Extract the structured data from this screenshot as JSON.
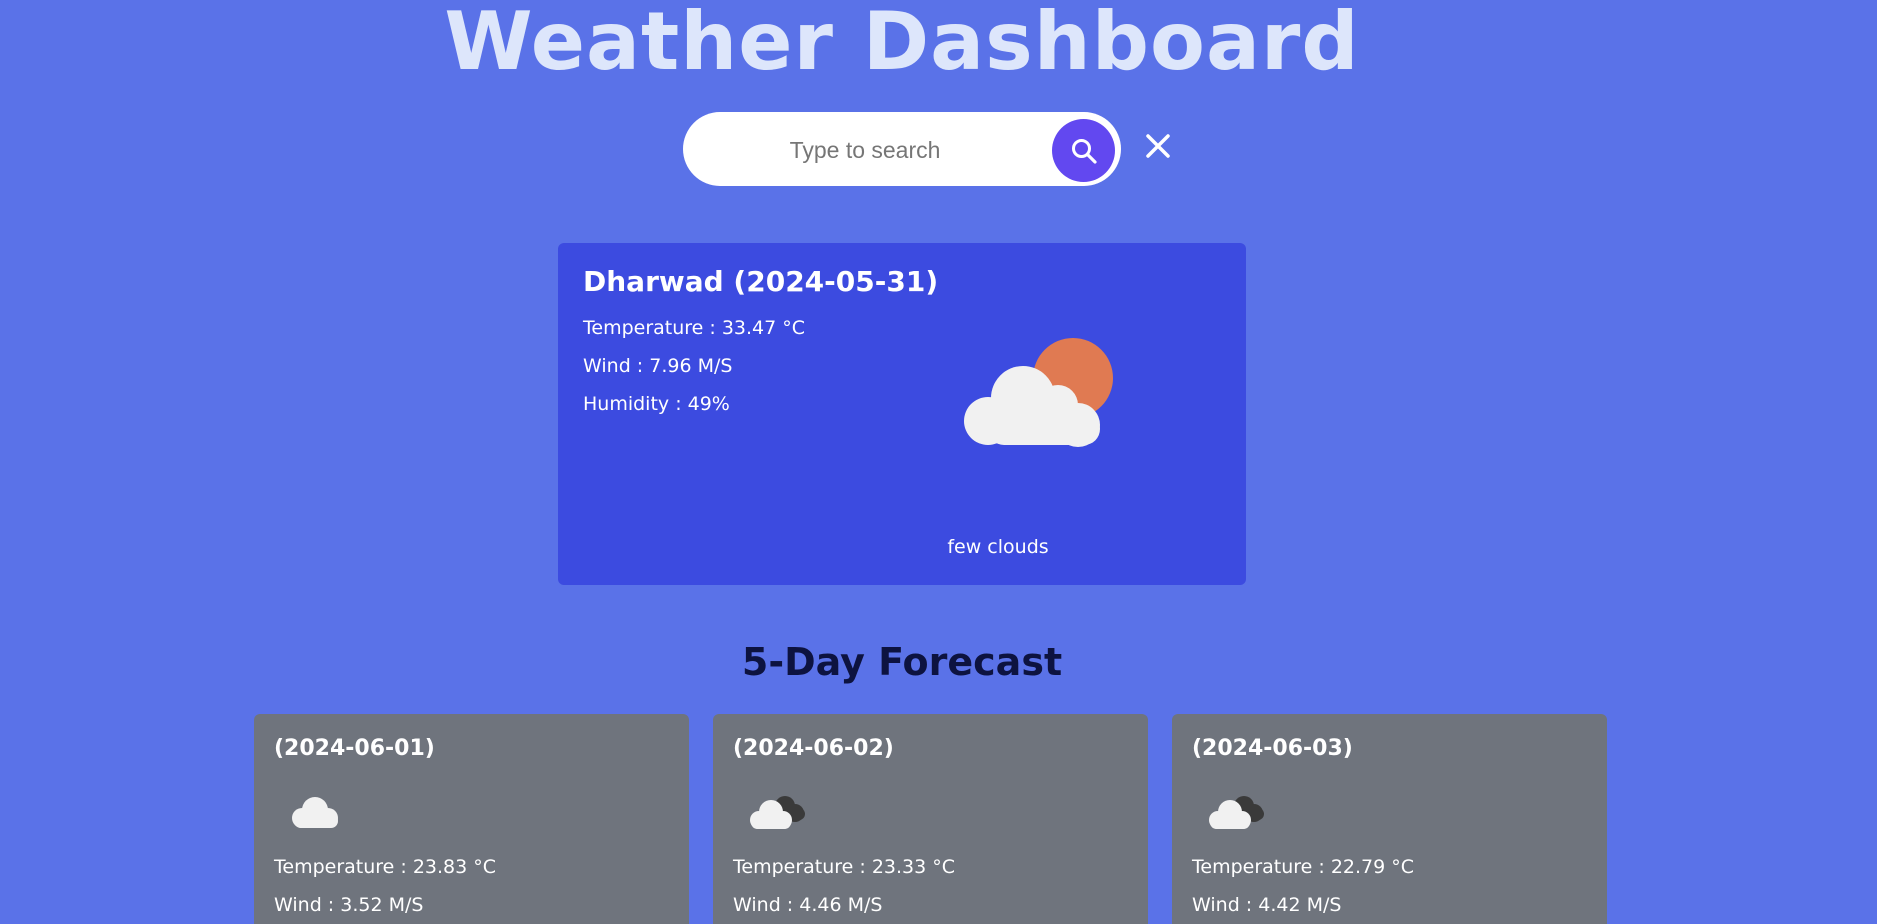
{
  "header": {
    "title": "Weather Dashboard"
  },
  "search": {
    "placeholder": "Type to search",
    "value": "",
    "search_icon": "search-icon",
    "clear_icon": "close-icon"
  },
  "current": {
    "heading": "Dharwad (2024-05-31)",
    "temperature": "Temperature : 33.47 °C",
    "wind": "Wind : 7.96 M/S",
    "humidity": "Humidity : 49%",
    "description": "few clouds",
    "icon": "few-clouds-icon"
  },
  "forecast": {
    "heading": "5-Day Forecast",
    "days": [
      {
        "date": "(2024-06-01)",
        "icon": "cloud-icon",
        "temperature": "Temperature : 23.83 °C",
        "wind": "Wind : 3.52 M/S"
      },
      {
        "date": "(2024-06-02)",
        "icon": "broken-clouds-icon",
        "temperature": "Temperature : 23.33 °C",
        "wind": "Wind : 4.46 M/S"
      },
      {
        "date": "(2024-06-03)",
        "icon": "broken-clouds-icon",
        "temperature": "Temperature : 22.79 °C",
        "wind": "Wind : 4.42 M/S"
      }
    ]
  },
  "colors": {
    "background": "#5a72e8",
    "current_card": "#3c4be0",
    "forecast_card": "#6f747d",
    "search_button": "#6248f0",
    "title": "#dde6fb",
    "sun": "#e07a52"
  }
}
